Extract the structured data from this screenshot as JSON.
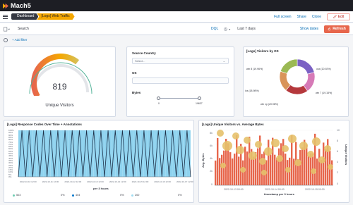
{
  "app": {
    "name": "Mach5"
  },
  "navbar": {
    "breadcrumbs": [
      "Dashboard",
      "[Logs] Web Traffic"
    ],
    "full_screen": "Full screen",
    "share": "Share",
    "clone": "Clone",
    "edit": "Edit"
  },
  "query": {
    "search": "Search",
    "language": "DQL",
    "time_range": "Last 7 days",
    "show_dates": "Show dates",
    "refresh": "Refresh"
  },
  "filter": {
    "add_filter": "+ Add filter"
  },
  "gauge": {
    "value": "819",
    "label": "Unique Visitors",
    "fraction": 0.66
  },
  "controls": {
    "source_country_label": "Source Country",
    "source_country_placeholder": "Select...",
    "os_label": "OS",
    "bytes_label": "Bytes",
    "bytes_min": "0",
    "bytes_max": "19637"
  },
  "donut": {
    "title": "[Logs] Visitors by OS",
    "labels": [
      "osx (20.92%)",
      "win 7 (19.15%)",
      "win xp (20.98%)",
      "ios (18.98%)",
      "win 8 (19.96%)"
    ],
    "colors": [
      "#7b61c4",
      "#d67ab7",
      "#b5383c",
      "#d99459",
      "#9bb954"
    ]
  },
  "bar_chart": {
    "title": "[Logs] Response Codes Over Time + Annotations",
    "y_ticks": [
      "100%",
      "95%",
      "90%",
      "85%",
      "80%",
      "75%",
      "70%",
      "65%",
      "60%",
      "55%",
      "50%",
      "45%",
      "40%",
      "35%",
      "30%",
      "25%",
      "20%",
      "15%",
      "10%",
      "5%",
      "0%"
    ],
    "x_ticks": [
      "2022-10-10 12:00",
      "2022-10-11 12:00",
      "2022-10-12 12:00",
      "2022-10-13 12:00",
      "2022-10-14 12:00",
      "2022-10-15 12:00",
      "2022-10-16 12:00",
      "2022-10-17 12:00"
    ],
    "x_title": "per 3 hours",
    "legend": [
      {
        "name": "503",
        "value": "0%",
        "color": "#6dccb1"
      },
      {
        "name": "404",
        "value": "0%",
        "color": "#0077cc"
      },
      {
        "name": "200",
        "value": "0%",
        "color": "#9fdcf2"
      }
    ]
  },
  "bubble_chart": {
    "title": "[Logs] Unique Visitors vs. Average Bytes",
    "y_left_title": "Avg. Bytes",
    "y_right_title": "Unique Visitors",
    "y_left_ticks": [
      "8k",
      "6k",
      "4k",
      "2k",
      "0"
    ],
    "y_right_ticks": [
      "10",
      "8",
      "6",
      "4",
      "2",
      "0"
    ],
    "x_ticks": [
      "2022-10-13 00:00",
      "2022-10-14 00:00",
      "2022-10-15 00:00"
    ],
    "x_title": "timestamp per 3 hours"
  },
  "chart_data": [
    {
      "type": "bar",
      "title": "[Logs] Response Codes Over Time + Annotations",
      "xlabel": "per 3 hours",
      "ylabel": "",
      "ylim": [
        0,
        100
      ],
      "categories": [
        "2022-10-10 12:00",
        "2022-10-11 12:00",
        "2022-10-12 12:00",
        "2022-10-13 12:00",
        "2022-10-14 12:00",
        "2022-10-15 12:00",
        "2022-10-16 12:00",
        "2022-10-17 12:00"
      ],
      "series": [
        {
          "name": "503",
          "values": [
            0,
            0,
            0,
            0,
            0,
            0,
            0,
            0
          ]
        },
        {
          "name": "404",
          "values": [
            0,
            0,
            0,
            0,
            0,
            0,
            0,
            0
          ]
        },
        {
          "name": "200",
          "values": [
            100,
            100,
            100,
            100,
            100,
            100,
            100,
            100
          ]
        }
      ]
    },
    {
      "type": "bar",
      "title": "[Logs] Unique Visitors vs. Average Bytes",
      "xlabel": "timestamp per 3 hours",
      "ylabel": "Avg. Bytes",
      "ylim": [
        0,
        9000
      ],
      "categories": [
        "2022-10-13 00:00",
        "2022-10-14 00:00",
        "2022-10-15 00:00"
      ],
      "series": [
        {
          "name": "Avg. Bytes",
          "values": [
            5500,
            6000,
            5800
          ]
        },
        {
          "name": "Unique Visitors",
          "values": [
            6,
            7,
            6
          ]
        }
      ]
    }
  ]
}
